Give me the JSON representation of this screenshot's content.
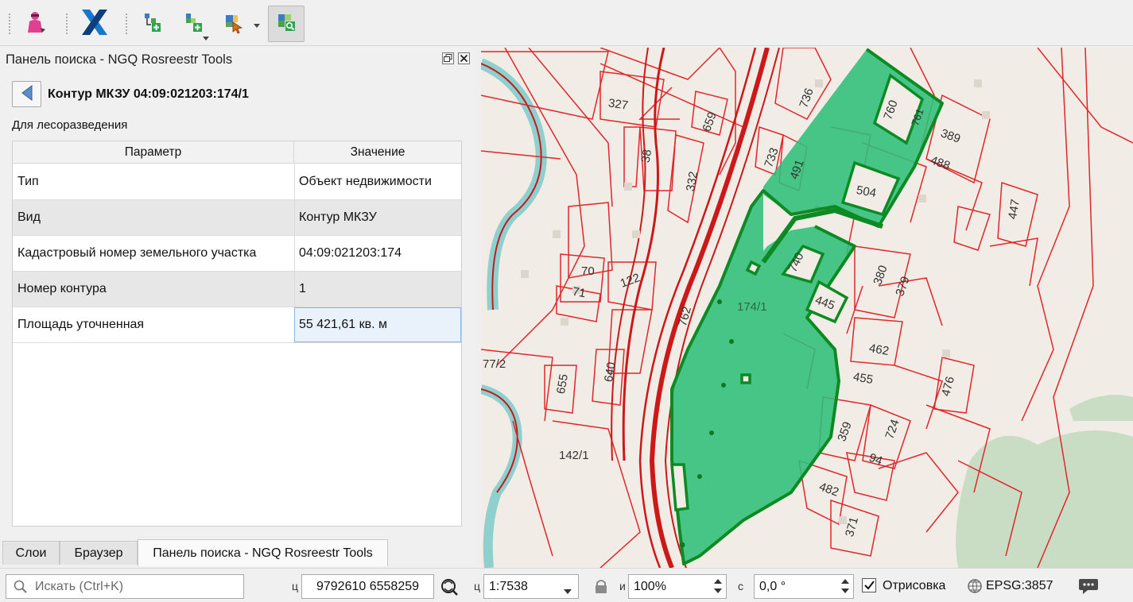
{
  "toolbar": {
    "buttons": [
      {
        "name": "identify-tool-icon"
      },
      {
        "name": "ngq-x-logo-icon"
      },
      {
        "name": "add-layer-icon"
      },
      {
        "name": "add-layer-menu-icon"
      },
      {
        "name": "select-features-icon"
      },
      {
        "name": "search-panel-icon",
        "active": true
      }
    ]
  },
  "panel": {
    "title": "Панель поиска - NGQ Rosreestr Tools",
    "object_title": "Контур МКЗУ 04:09:021203:174/1",
    "object_subtitle": "Для лесоразведения",
    "table": {
      "headers": [
        "Параметр",
        "Значение"
      ],
      "rows": [
        {
          "param": "Тип",
          "value": "Объект недвижимости"
        },
        {
          "param": "Вид",
          "value": "Контур МКЗУ"
        },
        {
          "param": "Кадастровый номер земельного участка",
          "value": "04:09:021203:174"
        },
        {
          "param": "Номер контура",
          "value": "1"
        },
        {
          "param": "Площадь уточненная",
          "value": "55 421,61 кв. м"
        }
      ]
    }
  },
  "tabs": [
    {
      "label": "Слои",
      "active": false
    },
    {
      "label": "Браузер",
      "active": false
    },
    {
      "label": "Панель поиска - NGQ Rosreestr Tools",
      "active": true
    }
  ],
  "map": {
    "parcel_labels": [
      "327",
      "659",
      "736",
      "760",
      "761",
      "389",
      "488",
      "38",
      "332",
      "733",
      "491",
      "504",
      "447",
      "70",
      "71",
      "122",
      "740",
      "380",
      "379",
      "762",
      "174/1",
      "445",
      "462",
      "455",
      "476",
      "655",
      "640",
      "359",
      "724",
      "94",
      "142/1",
      "482",
      "371",
      "77/2"
    ],
    "colors": {
      "parcel_fill": "#2fbf7a",
      "parcel_stroke": "#0d8a23",
      "cadastral_lines": "#e0262b",
      "road": "#cc1818",
      "river": "#8fd0cf",
      "forest": "#c9dcc4",
      "background": "#f1ede6"
    }
  },
  "status": {
    "search_placeholder": "Искать (Ctrl+K)",
    "coord_label": "ц",
    "coordinates": "9792610  6558259",
    "scale_label": "ц",
    "scale": "1:7538",
    "magnifier_label": "и",
    "magnifier": "100%",
    "rotation_label": "с",
    "rotation": "0,0 °",
    "render_checked": true,
    "render_label": "Отрисовка",
    "crs": "EPSG:3857"
  }
}
